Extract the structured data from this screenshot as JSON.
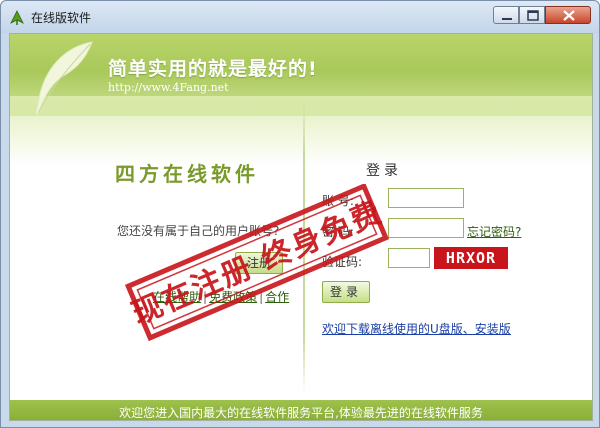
{
  "window": {
    "title": "在线版软件"
  },
  "banner": {
    "slogan": "简单实用的就是最好的!",
    "url": "http://www.4Fang.net"
  },
  "left": {
    "brand_title": "四方在线软件",
    "no_account_text": "您还没有属于自己的用户账号?",
    "register_label": "注册",
    "links": [
      "在线帮助",
      "免费政策",
      "合作"
    ]
  },
  "stamp": {
    "text": "现在注册 终身免费",
    "color": "#c8141a"
  },
  "login": {
    "heading": "登录",
    "account_label": "账  号:",
    "password_label": "密  码:",
    "captcha_label": "验证码:",
    "forgot_label": "忘记密码?",
    "captcha_value": "HRXOR",
    "login_label": "登录",
    "download_label": "欢迎下载离线使用的U盘版、安装版"
  },
  "footer": {
    "text": "欢迎您进入国内最大的在线软件服务平台,体验最先进的在线软件服务"
  },
  "colors": {
    "accent_green": "#9fc14d",
    "brand_green": "#7a9a2c",
    "link_blue": "#1a3fa6",
    "stamp_red": "#c8141a"
  }
}
